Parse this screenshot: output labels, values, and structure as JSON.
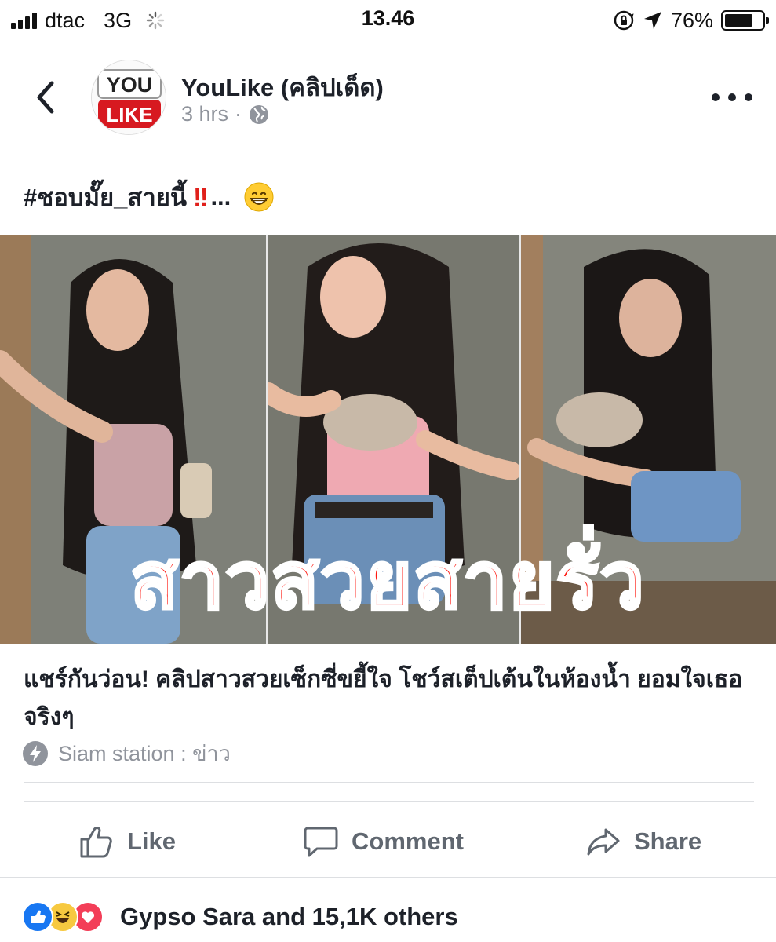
{
  "status_bar": {
    "carrier": "dtac",
    "network": "3G",
    "time": "13.46",
    "battery_percent": "76%",
    "battery_level": 0.76
  },
  "post": {
    "page_name": "YouLike (คลิปเด็ด)",
    "time_ago": "3 hrs",
    "separator": "·",
    "privacy_icon": "globe-icon",
    "caption_text": "#ชอบมั๊ย_สายนี้",
    "caption_bangs": "‼",
    "caption_ellipsis": "...",
    "avatar_logo_top": "YOU",
    "avatar_logo_bottom": "LIKE"
  },
  "media": {
    "overlay_text": "สาวสวยสายรั่ว"
  },
  "link": {
    "title": "แชร์กันว่อน! คลิปสาวสวยเซ็กซี่ขยี้ใจ โชว์สเต็ปเต้นในห้องน้ำ ยอมใจเธอจริงๆ",
    "source": "Siam station : ข่าว"
  },
  "actions": {
    "like": "Like",
    "comment": "Comment",
    "share": "Share"
  },
  "reactions": {
    "summary": "Gypso Sara and 15,1K others",
    "icons": [
      "like-icon",
      "haha-icon",
      "love-icon"
    ]
  },
  "colors": {
    "accent_blue": "#1877f2",
    "love_red": "#f33e58",
    "overlay_red": "#ff1a12",
    "muted_gray": "#90949c"
  }
}
